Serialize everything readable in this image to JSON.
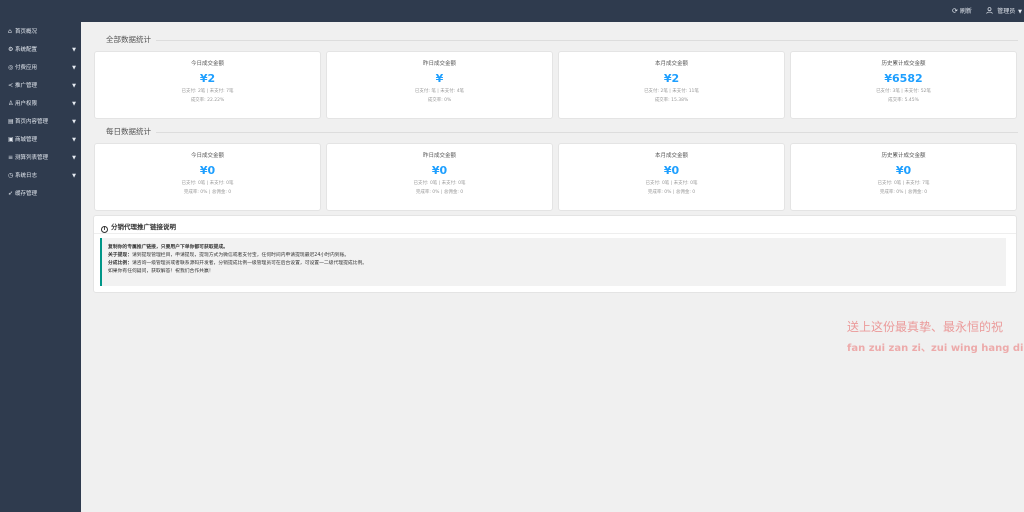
{
  "header": {
    "refresh_label": "刷新",
    "user_label": "管理员"
  },
  "sidebar": {
    "items": [
      {
        "label": "首页概况",
        "icon": "home-icon",
        "has_children": false
      },
      {
        "label": "系统配置",
        "icon": "gear-icon",
        "has_children": true
      },
      {
        "label": "付费应用",
        "icon": "app-icon",
        "has_children": true
      },
      {
        "label": "推广管理",
        "icon": "share-icon",
        "has_children": true
      },
      {
        "label": "用户权限",
        "icon": "user-icon",
        "has_children": true
      },
      {
        "label": "首页内容管理",
        "icon": "document-icon",
        "has_children": true
      },
      {
        "label": "商城管理",
        "icon": "shop-icon",
        "has_children": true
      },
      {
        "label": "测算列表管理",
        "icon": "list-icon",
        "has_children": true
      },
      {
        "label": "系统日志",
        "icon": "clock-icon",
        "has_children": true
      },
      {
        "label": "缓存管理",
        "icon": "send-icon",
        "has_children": false
      }
    ]
  },
  "sections": {
    "all": {
      "title": "全部数据统计",
      "cards": [
        {
          "title": "今日成交金额",
          "amount": "¥2",
          "line1": "已支付: 2笔 | 未支付: 7笔",
          "line2": "成交率: 22.22%"
        },
        {
          "title": "昨日成交金额",
          "amount": "¥",
          "line1": "已支付: 笔 | 未支付: 4笔",
          "line2": "成交率: 0%"
        },
        {
          "title": "本月成交金额",
          "amount": "¥2",
          "line1": "已支付: 2笔 | 未支付: 11笔",
          "line2": "成交率: 15.38%"
        },
        {
          "title": "历史累计成交金额",
          "amount": "¥6582",
          "line1": "已支付: 3笔 | 未支付: 52笔",
          "line2": "成交率: 5.45%"
        }
      ]
    },
    "daily": {
      "title": "每日数据统计",
      "cards": [
        {
          "title": "今日成交金额",
          "amount": "¥0",
          "line1": "已支付: 0笔 | 未支付: 0笔",
          "line2": "完成率: 0% | 总佣金: 0"
        },
        {
          "title": "昨日成交金额",
          "amount": "¥0",
          "line1": "已支付: 0笔 | 未支付: 0笔",
          "line2": "完成率: 0% | 总佣金: 0"
        },
        {
          "title": "本月成交金额",
          "amount": "¥0",
          "line1": "已支付: 0笔 | 未支付: 0笔",
          "line2": "完成率: 0% | 总佣金: 0"
        },
        {
          "title": "历史累计成交金额",
          "amount": "¥0",
          "line1": "已支付: 0笔 | 未支付: 7笔",
          "line2": "完成率: 0% | 总佣金: 0"
        }
      ]
    }
  },
  "notice": {
    "title": "分销代理推广链接说明",
    "line1": "复制你的专属推广链接，只要用户下单你都可获取提成。",
    "line2_label": "关于提现：",
    "line2_text": "请到提现管理栏目，申请提现，提现方式为微信或者支付宝，任何时间内申请提现最迟24小时内到账。",
    "line3_label": "分成比例：",
    "line3_text": "请咨询一级管理员或者联系源码开发者，分销提成比例一级管理员可在后台设置，可设置一二级代理提成比例。",
    "line4": "如果你有任何疑问，获取解答！祝我们合作共赢！"
  },
  "watermark": {
    "line1": "送上这份最真挚、最永恒的祝",
    "line2": "fan zui zan zi、zui wing hang di z"
  },
  "colors": {
    "sidebar_bg": "#2f3b4e",
    "accent_blue": "#1e9fff",
    "notice_border": "#009688"
  }
}
